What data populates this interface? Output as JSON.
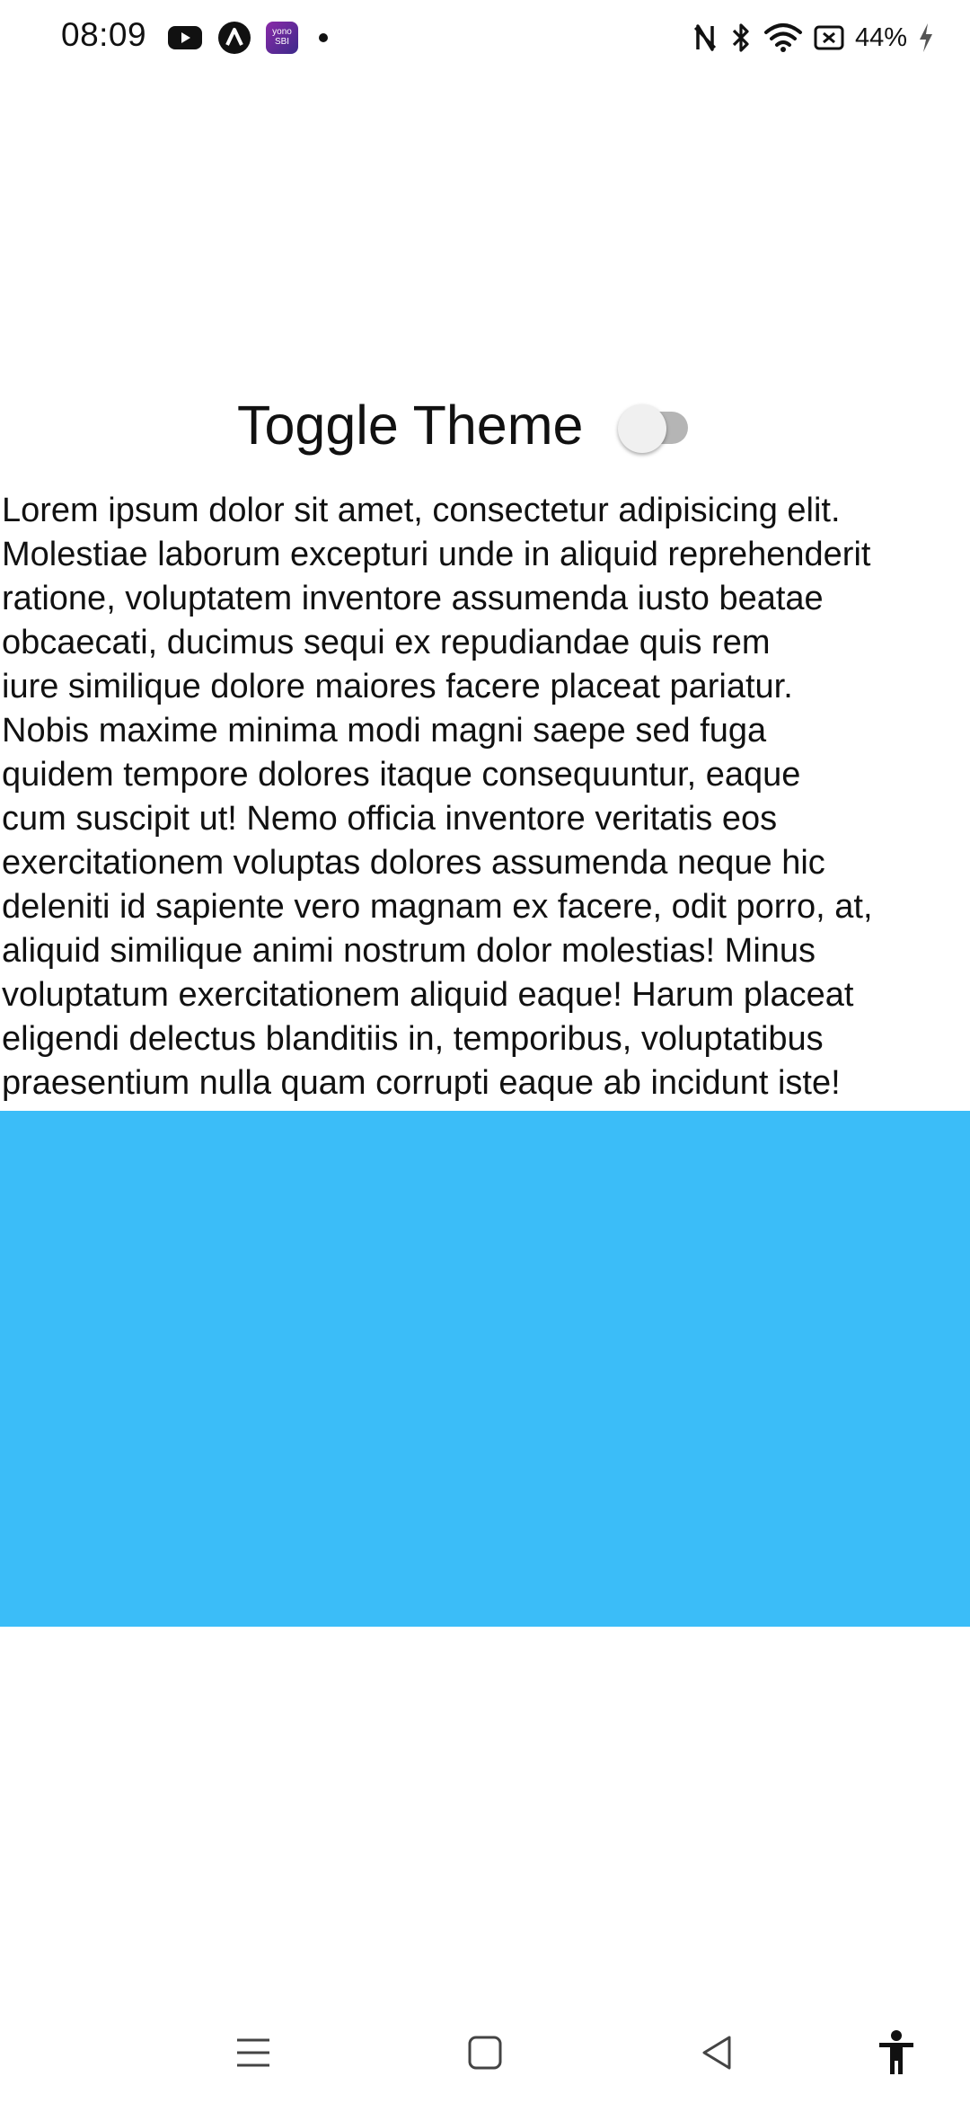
{
  "status_bar": {
    "time": "08:09",
    "battery": "44%",
    "notification_icons": [
      "youtube-icon",
      "app-a-icon",
      "yono-sbi-icon",
      "dot-icon"
    ],
    "notification_app_label_1": "yono",
    "notification_app_label_2": "SBI",
    "system_icons": [
      "nfc-icon",
      "bluetooth-icon",
      "wifi-icon",
      "battery-saver-icon",
      "charging-icon"
    ]
  },
  "toggle": {
    "label": "Toggle Theme",
    "state": "off"
  },
  "content": {
    "paragraph_lines": [
      "Lorem ipsum dolor sit amet, consectetur adipisicing elit.",
      "Molestiae laborum excepturi unde in aliquid reprehenderit",
      "ratione, voluptatem inventore assumenda iusto beatae",
      "obcaecati, ducimus sequi ex repudiandae quis rem",
      "iure similique dolore maiores facere placeat pariatur.",
      "Nobis maxime minima modi magni saepe sed fuga",
      "quidem tempore dolores itaque consequuntur, eaque",
      "cum suscipit ut! Nemo officia inventore veritatis eos",
      "exercitationem voluptas dolores assumenda neque hic",
      "deleniti id sapiente vero magnam ex facere, odit porro, at,",
      "aliquid similique animi nostrum dolor molestias! Minus",
      "voluptatum exercitationem aliquid eaque! Harum placeat",
      "eligendi delectus blanditiis in, temporibus, voluptatibus",
      "praesentium nulla quam corrupti eaque ab incidunt iste!"
    ]
  },
  "colors": {
    "blue_box": "#3bbdf8",
    "switch_track": "#b5b5b5",
    "switch_thumb": "#f0f0f0"
  },
  "nav_bar": {
    "buttons": [
      "menu-icon",
      "home-icon",
      "back-icon",
      "accessibility-icon"
    ]
  }
}
